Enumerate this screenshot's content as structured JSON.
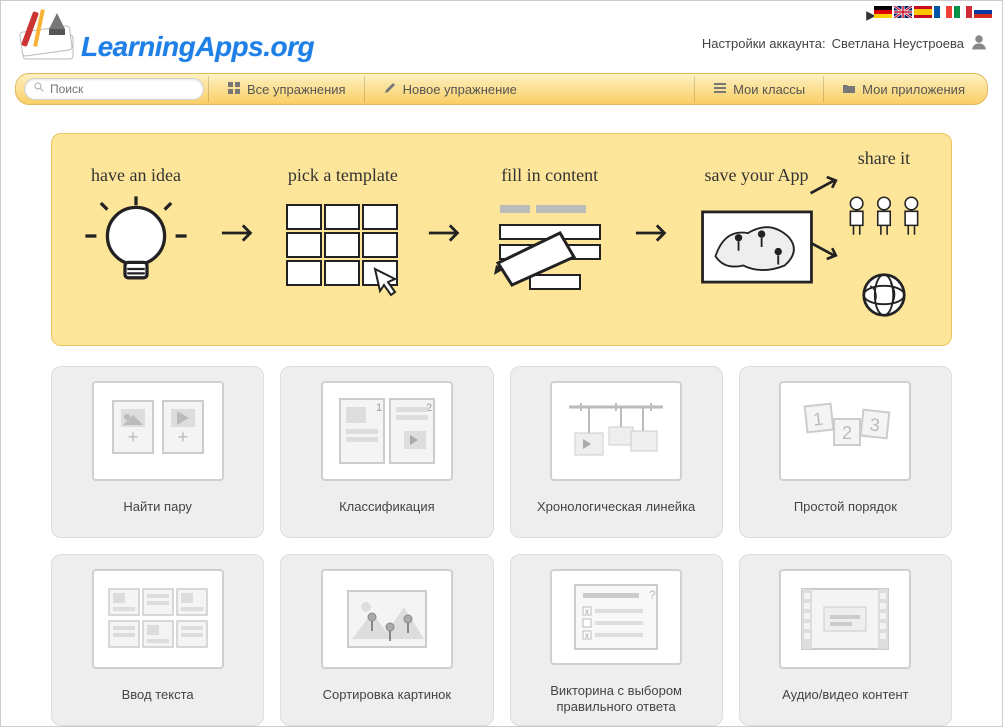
{
  "site": {
    "title": "LearningApps.org"
  },
  "account": {
    "prefix": "Настройки аккаунта:",
    "name": "Светлана Неустроева"
  },
  "search": {
    "placeholder": "Поиск"
  },
  "nav": {
    "all_exercises": "Все упражнения",
    "new_exercise": "Новое упражнение",
    "my_classes": "Мои классы",
    "my_apps": "Мои приложения"
  },
  "workflow": {
    "step1": "have an idea",
    "step2": "pick a template",
    "step3": "fill in content",
    "step4": "save your App",
    "step5": "share it"
  },
  "templates": [
    {
      "label": "Найти пару"
    },
    {
      "label": "Классификация"
    },
    {
      "label": "Хронологическая линейка"
    },
    {
      "label": "Простой порядок"
    },
    {
      "label": "Ввод текста"
    },
    {
      "label": "Сортировка картинок"
    },
    {
      "label": "Викторина с выбором правильного ответа"
    },
    {
      "label": "Аудио/видео контент"
    }
  ],
  "flags": [
    "de",
    "en",
    "es",
    "fr",
    "it",
    "ru"
  ]
}
